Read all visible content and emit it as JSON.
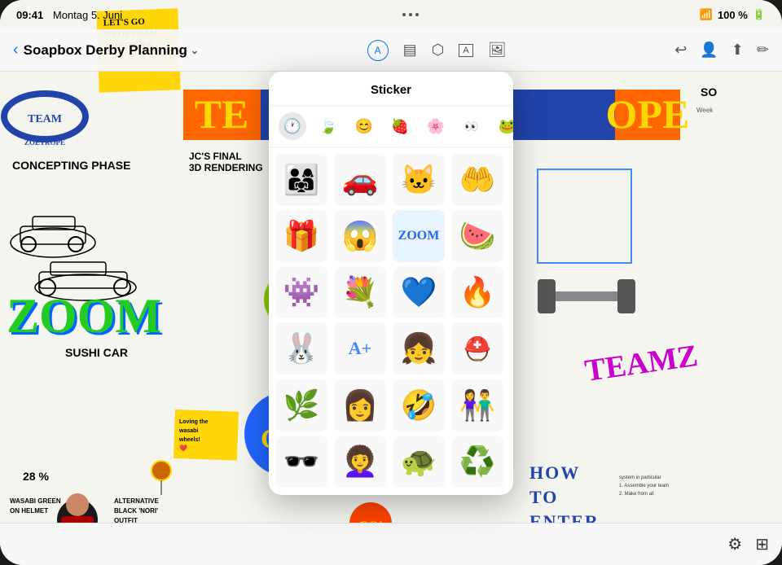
{
  "statusBar": {
    "time": "09:41",
    "date": "Montag 5. Juni",
    "battery": "100 %",
    "dots": [
      "•",
      "•",
      "•"
    ]
  },
  "navBar": {
    "backLabel": "‹",
    "title": "Soapbox Derby Planning",
    "titleChevron": "∨",
    "centerIcons": [
      "⊕",
      "▤",
      "⬆",
      "A",
      "⬛"
    ],
    "rightIcons": [
      "↩",
      "👤",
      "⬆",
      "✏"
    ]
  },
  "sticker": {
    "title": "Sticker",
    "categories": [
      {
        "name": "recent",
        "icon": "🕐"
      },
      {
        "name": "leaf",
        "icon": "🍃"
      },
      {
        "name": "emoji",
        "icon": "😊"
      },
      {
        "name": "strawberry",
        "icon": "🍓"
      },
      {
        "name": "flower",
        "icon": "🌸"
      },
      {
        "name": "eyes",
        "icon": "👀"
      },
      {
        "name": "frog",
        "icon": "🐸"
      }
    ],
    "stickers": [
      {
        "emoji": "👨‍👩‍👧",
        "label": "family"
      },
      {
        "emoji": "🚗",
        "label": "red car"
      },
      {
        "emoji": "🐱",
        "label": "cat"
      },
      {
        "emoji": "🤲",
        "label": "hands"
      },
      {
        "emoji": "🎁",
        "label": "gift"
      },
      {
        "emoji": "😱",
        "label": "scared"
      },
      {
        "emoji": "ZOOM",
        "label": "zoom text"
      },
      {
        "emoji": "🍉",
        "label": "watermelon"
      },
      {
        "emoji": "👾",
        "label": "monster"
      },
      {
        "emoji": "💐",
        "label": "flowers"
      },
      {
        "emoji": "💙",
        "label": "blue heart"
      },
      {
        "emoji": "🔥",
        "label": "fire car"
      },
      {
        "emoji": "🐰",
        "label": "rabbit"
      },
      {
        "emoji": "🅰➕",
        "label": "A plus"
      },
      {
        "emoji": "👧",
        "label": "girl"
      },
      {
        "emoji": "⛑️",
        "label": "helmet"
      },
      {
        "emoji": "🌿",
        "label": "plant"
      },
      {
        "emoji": "👩",
        "label": "woman"
      },
      {
        "emoji": "🤣",
        "label": "laughing"
      },
      {
        "emoji": "👫",
        "label": "couple"
      },
      {
        "emoji": "🕶",
        "label": "cool"
      },
      {
        "emoji": "👩‍🦱",
        "label": "woman curly"
      },
      {
        "emoji": "🐢",
        "label": "turtle"
      },
      {
        "emoji": "♻️",
        "label": "recycle"
      }
    ]
  },
  "canvas": {
    "stickyNote": {
      "text": "LET'S GO WITH TEAM ZOETROPE"
    },
    "teamBand": {
      "text": "TE"
    },
    "conceptingPhase": "CONCEPTING PHASE",
    "zoomGraffiti": "ZOOM",
    "goButton": "GO!",
    "teamzSticker": "TEAMZ",
    "howToEnter": "HOW TO ENTER",
    "percentText": "28 %",
    "renderingLabel": "JC'S FINAL 3D RENDERING",
    "sushiCar": "SUSHI CAR",
    "lovinWasabi": "Loving the wasabi wheels! ❤",
    "wasabiNotes": "WASABI GREEN ON HELMET\nALTERNATIVE BLACK 'NORI' OUTFIT"
  },
  "bottomToolbar": {
    "icons": [
      "⚙",
      "⊞"
    ]
  },
  "colors": {
    "accent": "#007AFF",
    "yellow": "#FFD60A",
    "blue": "#2244AA",
    "green": "#22CC22",
    "orange": "#FF6600",
    "panelBg": "#ffffff"
  }
}
